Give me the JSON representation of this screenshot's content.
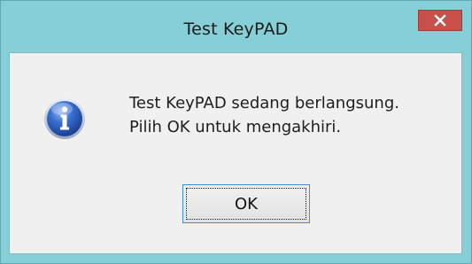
{
  "window": {
    "title": "Test KeyPAD"
  },
  "titlebar": {
    "close_icon": "close-icon",
    "close_color": "#c7504a"
  },
  "dialog": {
    "icon": "info-icon",
    "message_line1": "Test KeyPAD sedang berlangsung.",
    "message_line2": "Pilih OK untuk mengakhiri.",
    "ok_label": "OK"
  },
  "colors": {
    "frame": "#87cfd6",
    "client": "#f0f0f0",
    "focus_border": "#3c8fd8"
  }
}
